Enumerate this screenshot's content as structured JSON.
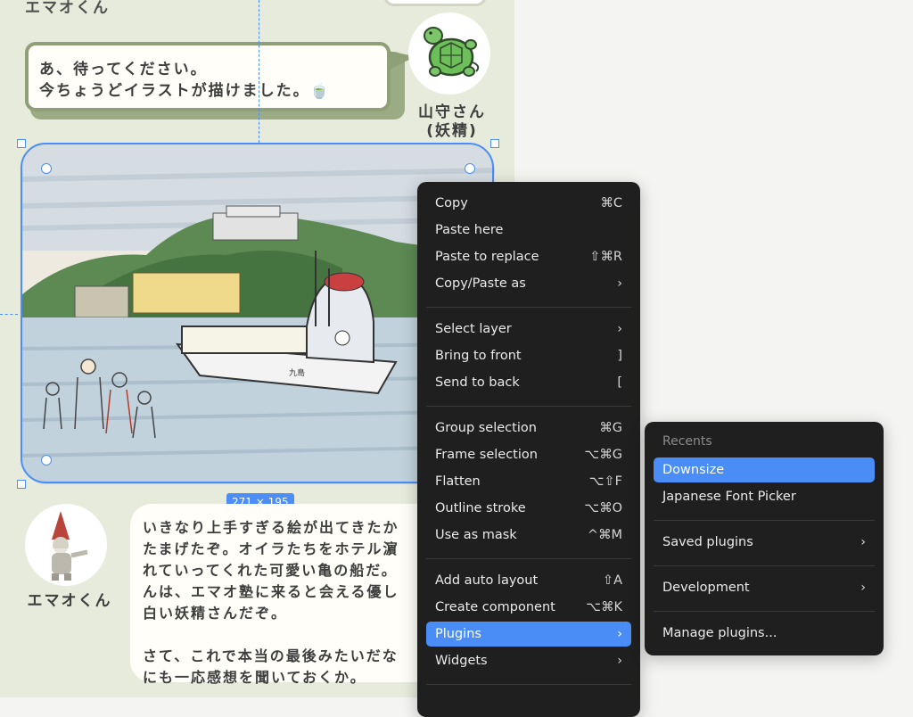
{
  "canvas": {
    "top_speaker_name": "エマオくん",
    "bubble_text": "あ、待ってください。\n今ちょうどイラストが描けました。🍵",
    "turtle_name": "山守さん\n(妖精)",
    "gnome_name": "エマオくん",
    "selection_size": "271 × 195",
    "bottom_text": "いきなり上手すぎる絵が出てきたか\nたまげたぞ。オイラたちをホテル濵\nれていってくれた可愛い亀の船だ。\nんは、エマオ塾に来ると会える優し\n白い妖精さんだぞ。\n\nさて、これで本当の最後みたいだな\nにも一応感想を聞いておくか。",
    "boat_label": "九島"
  },
  "context_menu": {
    "items": [
      {
        "label": "Copy",
        "shortcut": "⌘C"
      },
      {
        "label": "Paste here",
        "shortcut": ""
      },
      {
        "label": "Paste to replace",
        "shortcut": "⇧⌘R"
      },
      {
        "label": "Copy/Paste as",
        "shortcut": "›"
      },
      {
        "label": "Select layer",
        "shortcut": "›"
      },
      {
        "label": "Bring to front",
        "shortcut": "]"
      },
      {
        "label": "Send to back",
        "shortcut": "["
      },
      {
        "label": "Group selection",
        "shortcut": "⌘G"
      },
      {
        "label": "Frame selection",
        "shortcut": "⌥⌘G"
      },
      {
        "label": "Flatten",
        "shortcut": "⌥⇧F"
      },
      {
        "label": "Outline stroke",
        "shortcut": "⌥⌘O"
      },
      {
        "label": "Use as mask",
        "shortcut": "^⌘M"
      },
      {
        "label": "Add auto layout",
        "shortcut": "⇧A"
      },
      {
        "label": "Create component",
        "shortcut": "⌥⌘K"
      },
      {
        "label": "Plugins",
        "shortcut": "›"
      },
      {
        "label": "Widgets",
        "shortcut": "›"
      }
    ]
  },
  "plugins_submenu": {
    "header": "Recents",
    "items": [
      {
        "label": "Downsize",
        "shortcut": ""
      },
      {
        "label": "Japanese Font Picker",
        "shortcut": ""
      },
      {
        "label": "Saved plugins",
        "shortcut": "›"
      },
      {
        "label": "Development",
        "shortcut": "›"
      },
      {
        "label": "Manage plugins...",
        "shortcut": ""
      }
    ]
  },
  "colors": {
    "accent": "#4a8df6",
    "menu_bg": "#1f1f1f",
    "board_bg": "#e6ebdb",
    "bubble_border": "#8f9f78"
  }
}
